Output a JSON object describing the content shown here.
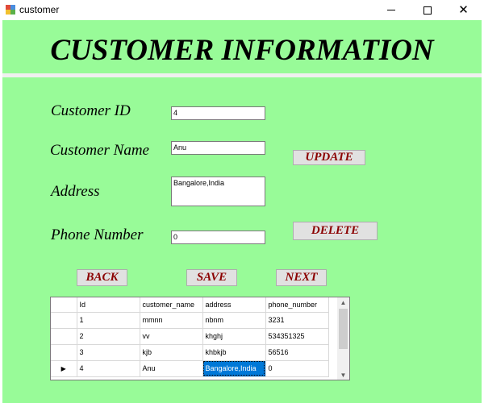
{
  "window": {
    "title": "customer"
  },
  "header": {
    "title": "CUSTOMER INFORMATION"
  },
  "form": {
    "customer_id_label": "Customer ID",
    "customer_id_value": "4",
    "customer_name_label": "Customer Name",
    "customer_name_value": "Anu",
    "address_label": "Address",
    "address_value": "Bangalore,India",
    "phone_label": "Phone Number",
    "phone_value": "0"
  },
  "buttons": {
    "update": "UPDATE",
    "delete": "DELETE",
    "back": "BACK",
    "save": "SAVE",
    "next": "NEXT"
  },
  "grid": {
    "columns": [
      "Id",
      "customer_name",
      "address",
      "phone_number"
    ],
    "rows": [
      {
        "id": "1",
        "customer_name": "mmnn",
        "address": "nbnm",
        "phone_number": "3231"
      },
      {
        "id": "2",
        "customer_name": "vv",
        "address": "khghj",
        "phone_number": "534351325"
      },
      {
        "id": "3",
        "customer_name": "kjb",
        "address": "khbkjb",
        "phone_number": "56516"
      },
      {
        "id": "4",
        "customer_name": "Anu",
        "address": "Bangalore,India",
        "phone_number": "0"
      }
    ],
    "current_row_marker": "▶"
  },
  "colors": {
    "background": "#98fb98",
    "button_text": "#8b0000",
    "selection": "#0078d7"
  }
}
